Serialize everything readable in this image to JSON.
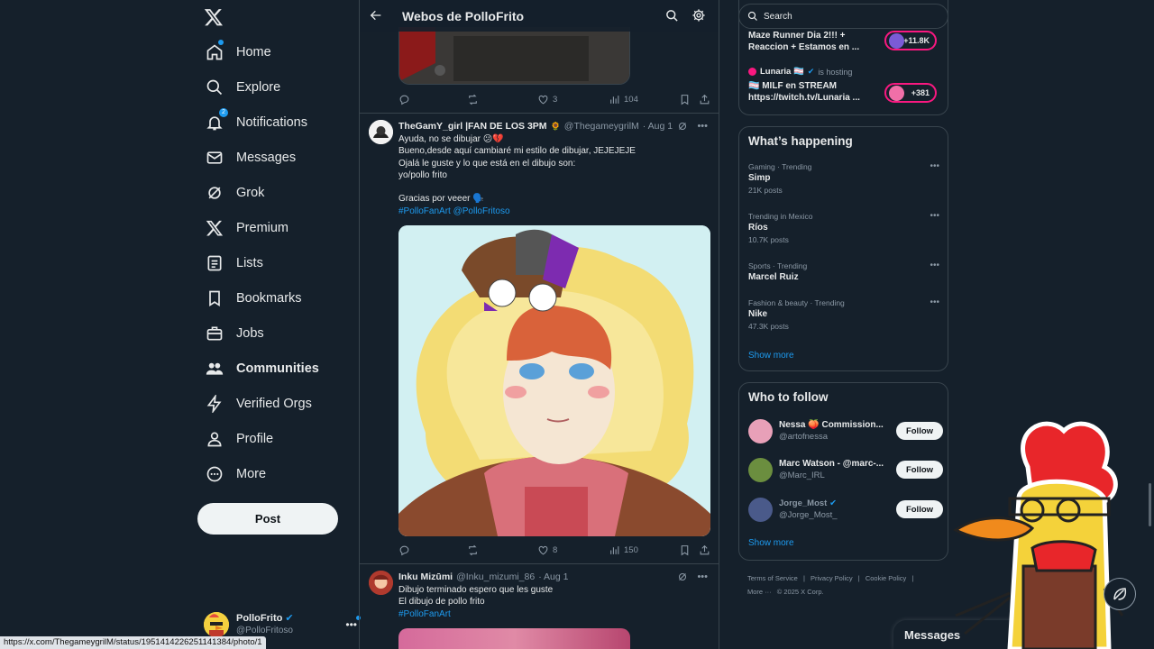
{
  "nav": {
    "items": [
      {
        "label": "Home",
        "icon": "home-icon"
      },
      {
        "label": "Explore",
        "icon": "search-icon"
      },
      {
        "label": "Notifications",
        "icon": "bell-icon",
        "badge": "2"
      },
      {
        "label": "Messages",
        "icon": "mail-icon"
      },
      {
        "label": "Grok",
        "icon": "grok-icon"
      },
      {
        "label": "Premium",
        "icon": "x-icon"
      },
      {
        "label": "Lists",
        "icon": "list-icon"
      },
      {
        "label": "Bookmarks",
        "icon": "bookmark-icon"
      },
      {
        "label": "Jobs",
        "icon": "briefcase-icon"
      },
      {
        "label": "Communities",
        "icon": "people-icon"
      },
      {
        "label": "Verified Orgs",
        "icon": "bolt-icon"
      },
      {
        "label": "Profile",
        "icon": "person-icon"
      },
      {
        "label": "More",
        "icon": "more-circle-icon"
      }
    ],
    "post_label": "Post",
    "account": {
      "name": "PolloFrito",
      "handle": "@PolloFritoso"
    }
  },
  "status_url": "https://x.com/ThegameygrilM/status/1951414226251141384/photo/1",
  "timeline": {
    "title": "Webos de PolloFrito",
    "top_post_stats": {
      "likes": "3",
      "views": "104"
    },
    "post2": {
      "name": "TheGamY_girl |FAN DE LOS 3PM",
      "handle": "@ThegameygrilM",
      "date": "· Aug 1",
      "lines": [
        "Ayuda, no se dibujar 😕💔",
        "Bueno,desde aquí cambiaré mi estilo de dibujar, JEJEJEJE",
        "Ojalá le guste y lo que está en el dibujo son:",
        "yo/pollo frito",
        "",
        "Gracias por veeer 🗣️"
      ],
      "tags": "#PolloFanArt @PolloFritoso",
      "likes": "8",
      "views": "150"
    },
    "post3": {
      "name": "Inku Mizūmi",
      "handle": "@Inku_mizumi_86",
      "date": "· Aug 1",
      "lines": [
        "Dibujo terminado espero que les guste",
        "El dibujo de pollo frito"
      ],
      "tags": "#PolloFanArt"
    }
  },
  "right": {
    "search_placeholder": "Search",
    "live": [
      {
        "title": "Maze Runner Dia 2!!! + Reaccion + Estamos en ...",
        "count": "+11.8K"
      },
      {
        "host": "Lunaria 🏳️‍⚧️",
        "host_note": "is hosting",
        "title": "🏳️‍⚧️ MILF en STREAM https://twitch.tv/Lunaria ...",
        "count": "+381"
      }
    ],
    "happening_title": "What’s happening",
    "trends": [
      {
        "meta": "Gaming · Trending",
        "name": "Simp",
        "count": "21K posts"
      },
      {
        "meta": "Trending in Mexico",
        "name": "Ríos",
        "count": "10.7K posts"
      },
      {
        "meta": "Sports · Trending",
        "name": "Marcel Ruiz",
        "count": ""
      },
      {
        "meta": "Fashion & beauty · Trending",
        "name": "Nike",
        "count": "47.3K posts"
      }
    ],
    "show_more": "Show more",
    "follow_title": "Who to follow",
    "who": [
      {
        "name": "Nessa 🍑 Commission...",
        "handle": "@artofnessa"
      },
      {
        "name": "Marc Watson - @marc-...",
        "handle": "@Marc_IRL"
      },
      {
        "name": "Jorge_Most",
        "handle": "@Jorge_Most_"
      }
    ],
    "follow_label": "Follow",
    "footer": [
      "Terms of Service",
      "|",
      "Privacy Policy",
      "|",
      "Cookie Policy",
      "|",
      "More ···",
      "© 2025 X Corp."
    ]
  },
  "messages_bar": "Messages",
  "colors": {
    "bg": "#15202b",
    "accent": "#1d9bf0",
    "border": "#38444d",
    "live": "#f91880"
  }
}
